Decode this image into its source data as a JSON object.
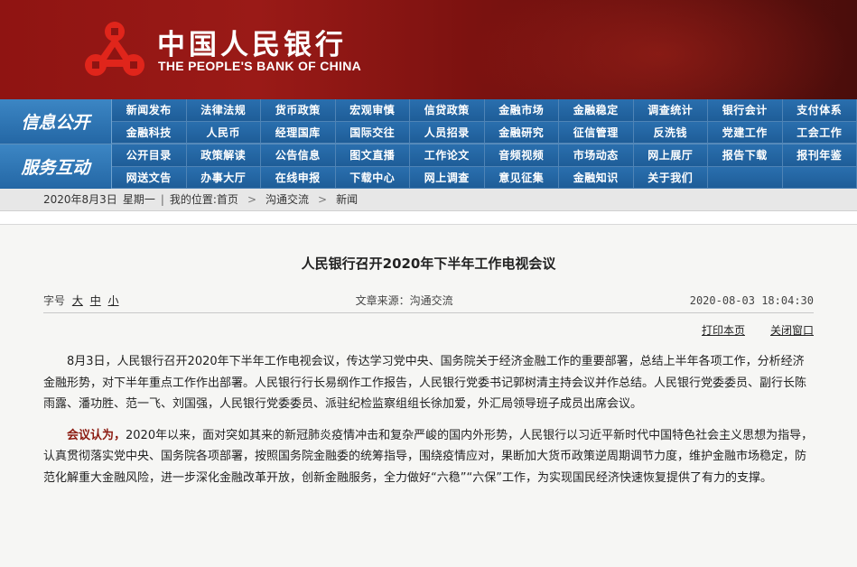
{
  "header": {
    "name_cn": "中国人民银行",
    "name_en": "THE PEOPLE'S BANK OF CHINA",
    "emblem_color": "#e0251b"
  },
  "nav": {
    "sections": [
      {
        "title": "信息公开",
        "links": [
          "新闻发布",
          "法律法规",
          "货币政策",
          "宏观审慎",
          "信贷政策",
          "金融市场",
          "金融稳定",
          "调查统计",
          "银行会计",
          "支付体系",
          "金融科技",
          "人民币",
          "经理国库",
          "国际交往",
          "人员招录",
          "金融研究",
          "征信管理",
          "反洗钱",
          "党建工作",
          "工会工作"
        ]
      },
      {
        "title": "服务互动",
        "links": [
          "公开目录",
          "政策解读",
          "公告信息",
          "图文直播",
          "工作论文",
          "音频视频",
          "市场动态",
          "网上展厅",
          "报告下载",
          "报刊年鉴",
          "网送文告",
          "办事大厅",
          "在线申报",
          "下载中心",
          "网上调查",
          "意见征集",
          "金融知识",
          "关于我们",
          "",
          ""
        ]
      }
    ]
  },
  "breadcrumb": {
    "date": "2020年8月3日",
    "weekday": "星期一",
    "location_label": "我的位置:",
    "home": "首页",
    "arrow": ">",
    "level1": "沟通交流",
    "level2": "新闻"
  },
  "article": {
    "title": "人民银行召开2020年下半年工作电视会议",
    "font_size_label": "字号",
    "size_large": "大",
    "size_medium": "中",
    "size_small": "小",
    "source": "文章来源：沟通交流",
    "timestamp": "2020-08-03 18:04:30",
    "print_label": "打印本页",
    "close_label": "关闭窗口",
    "paragraph1": "8月3日，人民银行召开2020年下半年工作电视会议，传达学习党中央、国务院关于经济金融工作的重要部署，总结上半年各项工作，分析经济金融形势，对下半年重点工作作出部署。人民银行行长易纲作工作报告，人民银行党委书记郭树清主持会议并作总结。人民银行党委委员、副行长陈雨露、潘功胜、范一飞、刘国强，人民银行党委委员、派驻纪检监察组组长徐加爱，外汇局领导班子成员出席会议。",
    "paragraph2_lead": "会议认为，",
    "paragraph2": "2020年以来，面对突如其来的新冠肺炎疫情冲击和复杂严峻的国内外形势，人民银行以习近平新时代中国特色社会主义思想为指导，认真贯彻落实党中央、国务院各项部署，按照国务院金融委的统筹指导，围绕疫情应对，果断加大货币政策逆周期调节力度，维护金融市场稳定，防范化解重大金融风险，进一步深化金融改革开放，创新金融服务，全力做好“六稳”“六保”工作，为实现国民经济快速恢复提供了有力的支撑。"
  }
}
